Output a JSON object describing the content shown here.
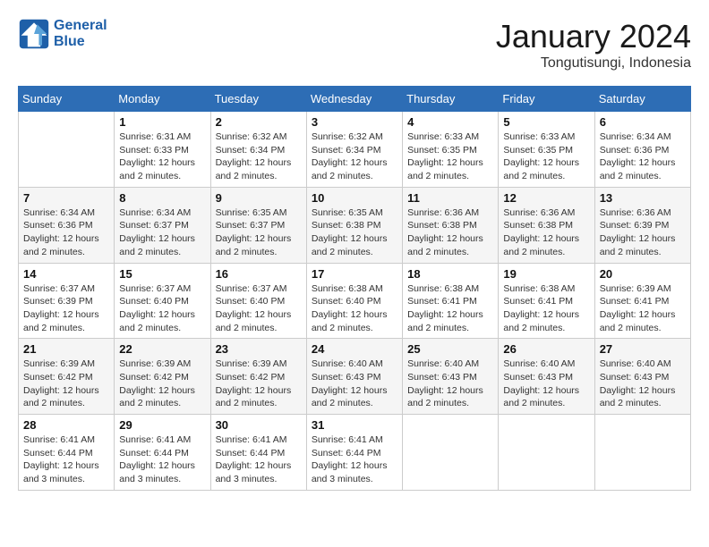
{
  "logo": {
    "line1": "General",
    "line2": "Blue"
  },
  "title": "January 2024",
  "location": "Tongutisungi, Indonesia",
  "days_of_week": [
    "Sunday",
    "Monday",
    "Tuesday",
    "Wednesday",
    "Thursday",
    "Friday",
    "Saturday"
  ],
  "weeks": [
    [
      null,
      {
        "day": 1,
        "sunrise": "6:31 AM",
        "sunset": "6:33 PM",
        "daylight": "12 hours and 2 minutes."
      },
      {
        "day": 2,
        "sunrise": "6:32 AM",
        "sunset": "6:34 PM",
        "daylight": "12 hours and 2 minutes."
      },
      {
        "day": 3,
        "sunrise": "6:32 AM",
        "sunset": "6:34 PM",
        "daylight": "12 hours and 2 minutes."
      },
      {
        "day": 4,
        "sunrise": "6:33 AM",
        "sunset": "6:35 PM",
        "daylight": "12 hours and 2 minutes."
      },
      {
        "day": 5,
        "sunrise": "6:33 AM",
        "sunset": "6:35 PM",
        "daylight": "12 hours and 2 minutes."
      },
      {
        "day": 6,
        "sunrise": "6:34 AM",
        "sunset": "6:36 PM",
        "daylight": "12 hours and 2 minutes."
      }
    ],
    [
      {
        "day": 7,
        "sunrise": "6:34 AM",
        "sunset": "6:36 PM",
        "daylight": "12 hours and 2 minutes."
      },
      {
        "day": 8,
        "sunrise": "6:34 AM",
        "sunset": "6:37 PM",
        "daylight": "12 hours and 2 minutes."
      },
      {
        "day": 9,
        "sunrise": "6:35 AM",
        "sunset": "6:37 PM",
        "daylight": "12 hours and 2 minutes."
      },
      {
        "day": 10,
        "sunrise": "6:35 AM",
        "sunset": "6:38 PM",
        "daylight": "12 hours and 2 minutes."
      },
      {
        "day": 11,
        "sunrise": "6:36 AM",
        "sunset": "6:38 PM",
        "daylight": "12 hours and 2 minutes."
      },
      {
        "day": 12,
        "sunrise": "6:36 AM",
        "sunset": "6:38 PM",
        "daylight": "12 hours and 2 minutes."
      },
      {
        "day": 13,
        "sunrise": "6:36 AM",
        "sunset": "6:39 PM",
        "daylight": "12 hours and 2 minutes."
      }
    ],
    [
      {
        "day": 14,
        "sunrise": "6:37 AM",
        "sunset": "6:39 PM",
        "daylight": "12 hours and 2 minutes."
      },
      {
        "day": 15,
        "sunrise": "6:37 AM",
        "sunset": "6:40 PM",
        "daylight": "12 hours and 2 minutes."
      },
      {
        "day": 16,
        "sunrise": "6:37 AM",
        "sunset": "6:40 PM",
        "daylight": "12 hours and 2 minutes."
      },
      {
        "day": 17,
        "sunrise": "6:38 AM",
        "sunset": "6:40 PM",
        "daylight": "12 hours and 2 minutes."
      },
      {
        "day": 18,
        "sunrise": "6:38 AM",
        "sunset": "6:41 PM",
        "daylight": "12 hours and 2 minutes."
      },
      {
        "day": 19,
        "sunrise": "6:38 AM",
        "sunset": "6:41 PM",
        "daylight": "12 hours and 2 minutes."
      },
      {
        "day": 20,
        "sunrise": "6:39 AM",
        "sunset": "6:41 PM",
        "daylight": "12 hours and 2 minutes."
      }
    ],
    [
      {
        "day": 21,
        "sunrise": "6:39 AM",
        "sunset": "6:42 PM",
        "daylight": "12 hours and 2 minutes."
      },
      {
        "day": 22,
        "sunrise": "6:39 AM",
        "sunset": "6:42 PM",
        "daylight": "12 hours and 2 minutes."
      },
      {
        "day": 23,
        "sunrise": "6:39 AM",
        "sunset": "6:42 PM",
        "daylight": "12 hours and 2 minutes."
      },
      {
        "day": 24,
        "sunrise": "6:40 AM",
        "sunset": "6:43 PM",
        "daylight": "12 hours and 2 minutes."
      },
      {
        "day": 25,
        "sunrise": "6:40 AM",
        "sunset": "6:43 PM",
        "daylight": "12 hours and 2 minutes."
      },
      {
        "day": 26,
        "sunrise": "6:40 AM",
        "sunset": "6:43 PM",
        "daylight": "12 hours and 2 minutes."
      },
      {
        "day": 27,
        "sunrise": "6:40 AM",
        "sunset": "6:43 PM",
        "daylight": "12 hours and 2 minutes."
      }
    ],
    [
      {
        "day": 28,
        "sunrise": "6:41 AM",
        "sunset": "6:44 PM",
        "daylight": "12 hours and 3 minutes."
      },
      {
        "day": 29,
        "sunrise": "6:41 AM",
        "sunset": "6:44 PM",
        "daylight": "12 hours and 3 minutes."
      },
      {
        "day": 30,
        "sunrise": "6:41 AM",
        "sunset": "6:44 PM",
        "daylight": "12 hours and 3 minutes."
      },
      {
        "day": 31,
        "sunrise": "6:41 AM",
        "sunset": "6:44 PM",
        "daylight": "12 hours and 3 minutes."
      },
      null,
      null,
      null
    ]
  ]
}
